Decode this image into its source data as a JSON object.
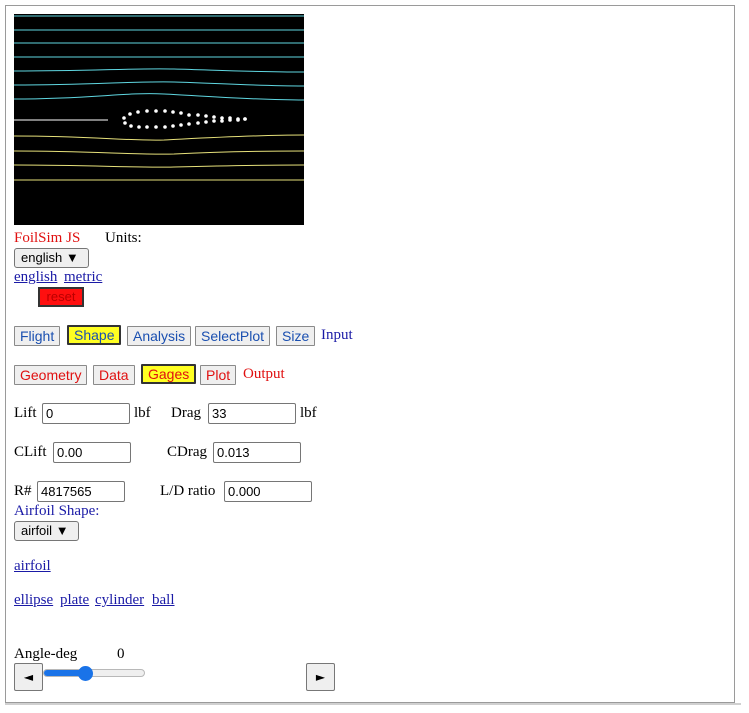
{
  "app": {
    "title": "FoilSim JS"
  },
  "units": {
    "label": "Units:",
    "selected": "english",
    "links": [
      "english",
      "metric"
    ],
    "reset_label": "reset"
  },
  "input_tabs": {
    "tabs": [
      {
        "label": "Flight",
        "active": false
      },
      {
        "label": "Shape",
        "active": true
      },
      {
        "label": "Analysis",
        "active": false
      },
      {
        "label": "SelectPlot",
        "active": false
      },
      {
        "label": "Size",
        "active": false
      }
    ],
    "suffix": "Input"
  },
  "output_tabs": {
    "tabs": [
      {
        "label": "Geometry",
        "active": false
      },
      {
        "label": "Data",
        "active": false
      },
      {
        "label": "Gages",
        "active": true
      },
      {
        "label": "Plot",
        "active": false
      }
    ],
    "suffix": "Output"
  },
  "readouts": {
    "lift": {
      "label": "Lift",
      "value": "0",
      "unit": "lbf"
    },
    "drag": {
      "label": "Drag",
      "value": "33",
      "unit": "lbf"
    },
    "clift": {
      "label": "CLift",
      "value": "0.00"
    },
    "cdrag": {
      "label": "CDrag",
      "value": "0.013"
    },
    "reynolds": {
      "label": "R#",
      "value": "4817565"
    },
    "ld_ratio": {
      "label": "L/D ratio",
      "value": "0.000"
    }
  },
  "shape": {
    "label": "Airfoil Shape:",
    "selected": "airfoil",
    "primary_link": "airfoil",
    "links": [
      "ellipse",
      "plate",
      "cylinder",
      "ball"
    ]
  },
  "angle": {
    "label": "Angle-deg",
    "value": "0",
    "slider_fraction": 0.4,
    "left_button": "◄",
    "right_button": "►"
  },
  "colors": {
    "title_red": "#e01010",
    "link_blue": "#1a1aa6",
    "active_tab": "#ffff22",
    "reset_red": "#ff0f0f",
    "streamline_upper": "#5fd6e0",
    "streamline_lower": "#e6e07a"
  }
}
